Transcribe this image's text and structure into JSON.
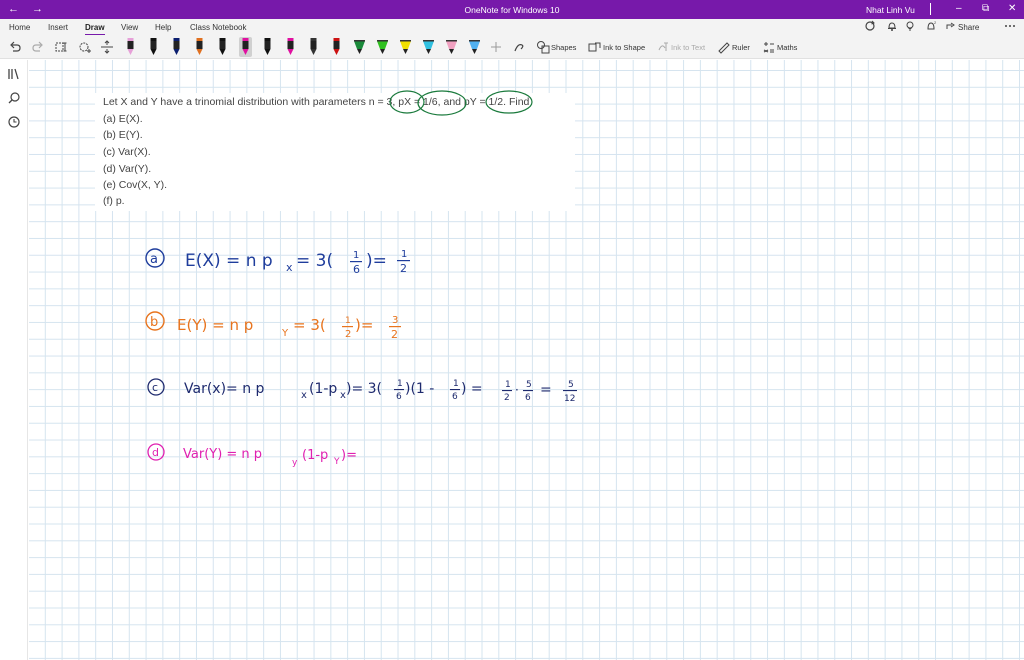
{
  "window": {
    "title": "OneNote for Windows 10",
    "user": "Nhat Linh Vu",
    "back_glyph": "←",
    "forward_glyph": "→",
    "minimize_glyph": "–",
    "restore_glyph": "⧉",
    "close_glyph": "✕"
  },
  "menu": {
    "tabs": [
      "Home",
      "Insert",
      "Draw",
      "View",
      "Help",
      "Class Notebook"
    ],
    "active_tab": "Draw"
  },
  "toolbar": {
    "right_actions": [
      {
        "icon": "sync-icon"
      },
      {
        "icon": "bell-icon"
      },
      {
        "icon": "lightbulb-icon"
      },
      {
        "icon": "notification-icon"
      },
      {
        "icon": "share-icon",
        "label": "Share"
      },
      {
        "icon": "more-icon"
      }
    ],
    "pen_colors": [
      "#e6a0d8",
      "#111111",
      "#0b1e6e",
      "#e07020",
      "#111111",
      "#e010a0",
      "#111111",
      "#e010a0",
      "#333333",
      "#cc1111",
      "#1a8a3a",
      "#30c020",
      "#f0e000",
      "#30c0e0",
      "#f0a0c0",
      "#50b0f0"
    ],
    "selected_pen_index": 5,
    "shapes_label": "Shapes",
    "ink_to_shape_label": "Ink to Shape",
    "ink_to_text_label": "Ink to Text",
    "ruler_label": "Ruler",
    "maths_label": "Maths"
  },
  "page": {
    "problem_lines": [
      "Let X and Y have a trinomial distribution with parameters n = 3, pX = 1/6, and pY = 1/2. Find",
      "(a) E(X).",
      "(b) E(Y).",
      "(c) Var(X).",
      "(d) Var(Y).",
      "(e) Cov(X, Y).",
      "(f) p."
    ],
    "ink_colors": {
      "blue": "#1f3d9c",
      "green": "#1a7a3c",
      "orange": "#e8741e",
      "navy": "#1e2a6e",
      "magenta": "#e020b0"
    },
    "handwriting": {
      "a": {
        "label": "a",
        "expr": "E(X) = n p",
        "sub": "x",
        "eq": "= 3(",
        "frac_num": "1",
        "frac_den": "6",
        "close": ")=",
        "res_num": "1",
        "res_den": "2"
      },
      "b": {
        "label": "b",
        "expr": "E(Y) = n p",
        "sub": "Y",
        "eq": "= 3(",
        "frac_num": "1",
        "frac_den": "2",
        "close": ")=",
        "res_num": "3",
        "res_den": "2"
      },
      "c": {
        "label": "c",
        "expr": "Var(x)= n p",
        "sub": "x",
        "mid": "(1-p",
        "mid_sub": "x",
        "eq": ")= 3(",
        "f1_num": "1",
        "f1_den": "6",
        "f1_close": ")(1 -",
        "f2_num": "1",
        "f2_den": "6",
        "f2_close": ") =",
        "p1_num": "1",
        "p1_den": "2",
        "dot": "·",
        "p2_num": "5",
        "p2_den": "6",
        "eq2": "=",
        "r_num": "5",
        "r_den": "12"
      },
      "d": {
        "label": "d",
        "expr": "Var(Y) = n p",
        "sub": "y",
        "mid": "(1-p",
        "mid_sub": "Y",
        "end": ")="
      }
    }
  }
}
